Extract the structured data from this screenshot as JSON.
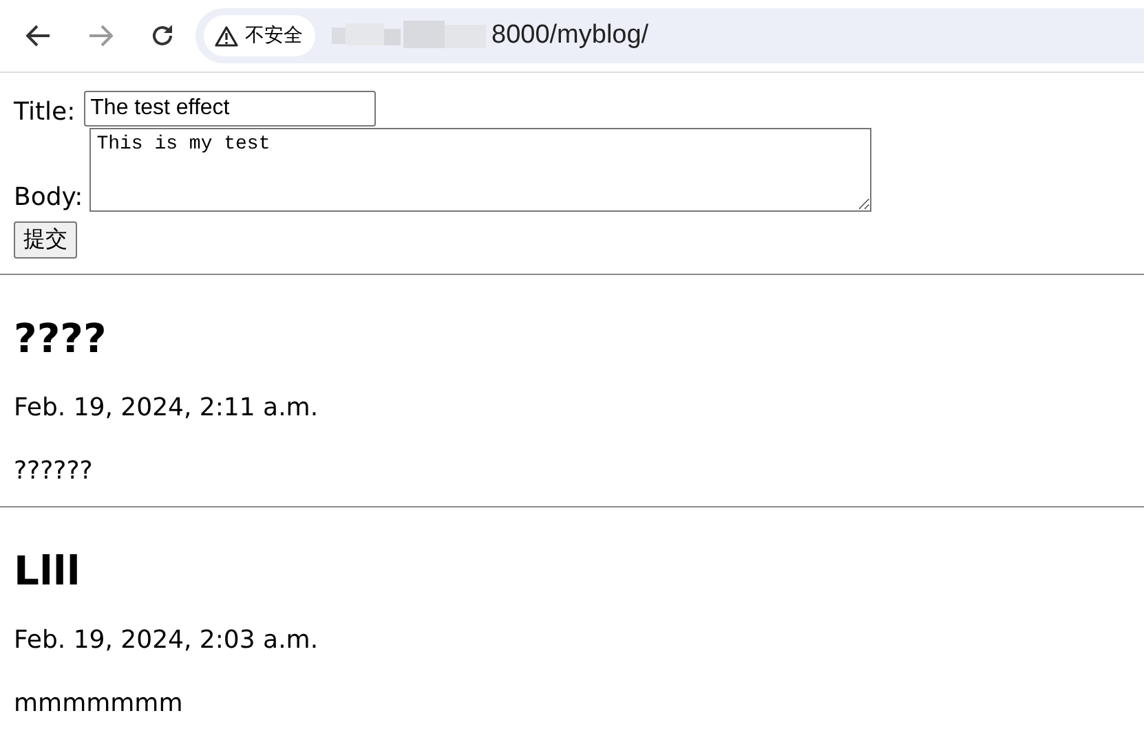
{
  "browser": {
    "security_label": "不安全",
    "url": "8000/myblog/"
  },
  "form": {
    "title_label": "Title:",
    "title_value": "The test effect",
    "body_label": "Body:",
    "body_value": "This is my test",
    "submit": "提交"
  },
  "posts": [
    {
      "title": "????",
      "date": "Feb. 19, 2024, 2:11 a.m.",
      "body": "??????"
    },
    {
      "title": "Llll",
      "date": "Feb. 19, 2024, 2:03 a.m.",
      "body": "mmmmmmm"
    }
  ]
}
